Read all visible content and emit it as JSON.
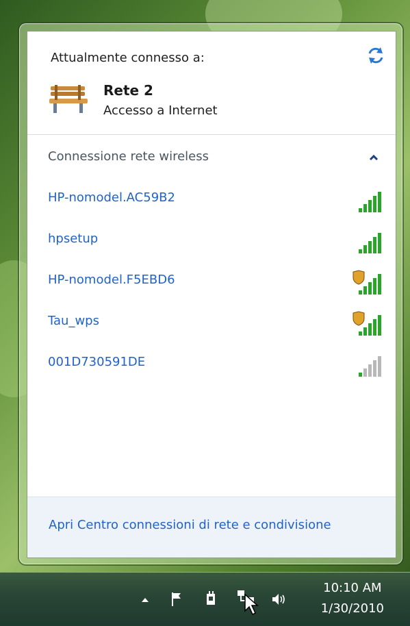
{
  "panel": {
    "header": "Attualmente connesso a:",
    "network": {
      "name": "Rete  2",
      "status": "Accesso a Internet"
    },
    "section_title": "Connessione rete wireless",
    "wireless_networks": [
      {
        "name": "HP-nomodel.AC59B2",
        "signal_bars": 5,
        "secured": false,
        "strength": "strong"
      },
      {
        "name": "hpsetup",
        "signal_bars": 5,
        "secured": false,
        "strength": "strong"
      },
      {
        "name": "HP-nomodel.F5EBD6",
        "signal_bars": 5,
        "secured": true,
        "strength": "strong"
      },
      {
        "name": "Tau_wps",
        "signal_bars": 5,
        "secured": true,
        "strength": "strong"
      },
      {
        "name": "001D730591DE",
        "signal_bars": 1,
        "secured": false,
        "strength": "weak"
      }
    ],
    "footer_link": "Apri Centro connessioni di rete e condivisione"
  },
  "taskbar": {
    "clock_time": "10:10 AM",
    "clock_date": "1/30/2010"
  },
  "colors": {
    "link": "#1f63c9",
    "signal_on": "#2aa52a",
    "signal_off": "#b8b8b8",
    "shield": "#e0a22a"
  }
}
